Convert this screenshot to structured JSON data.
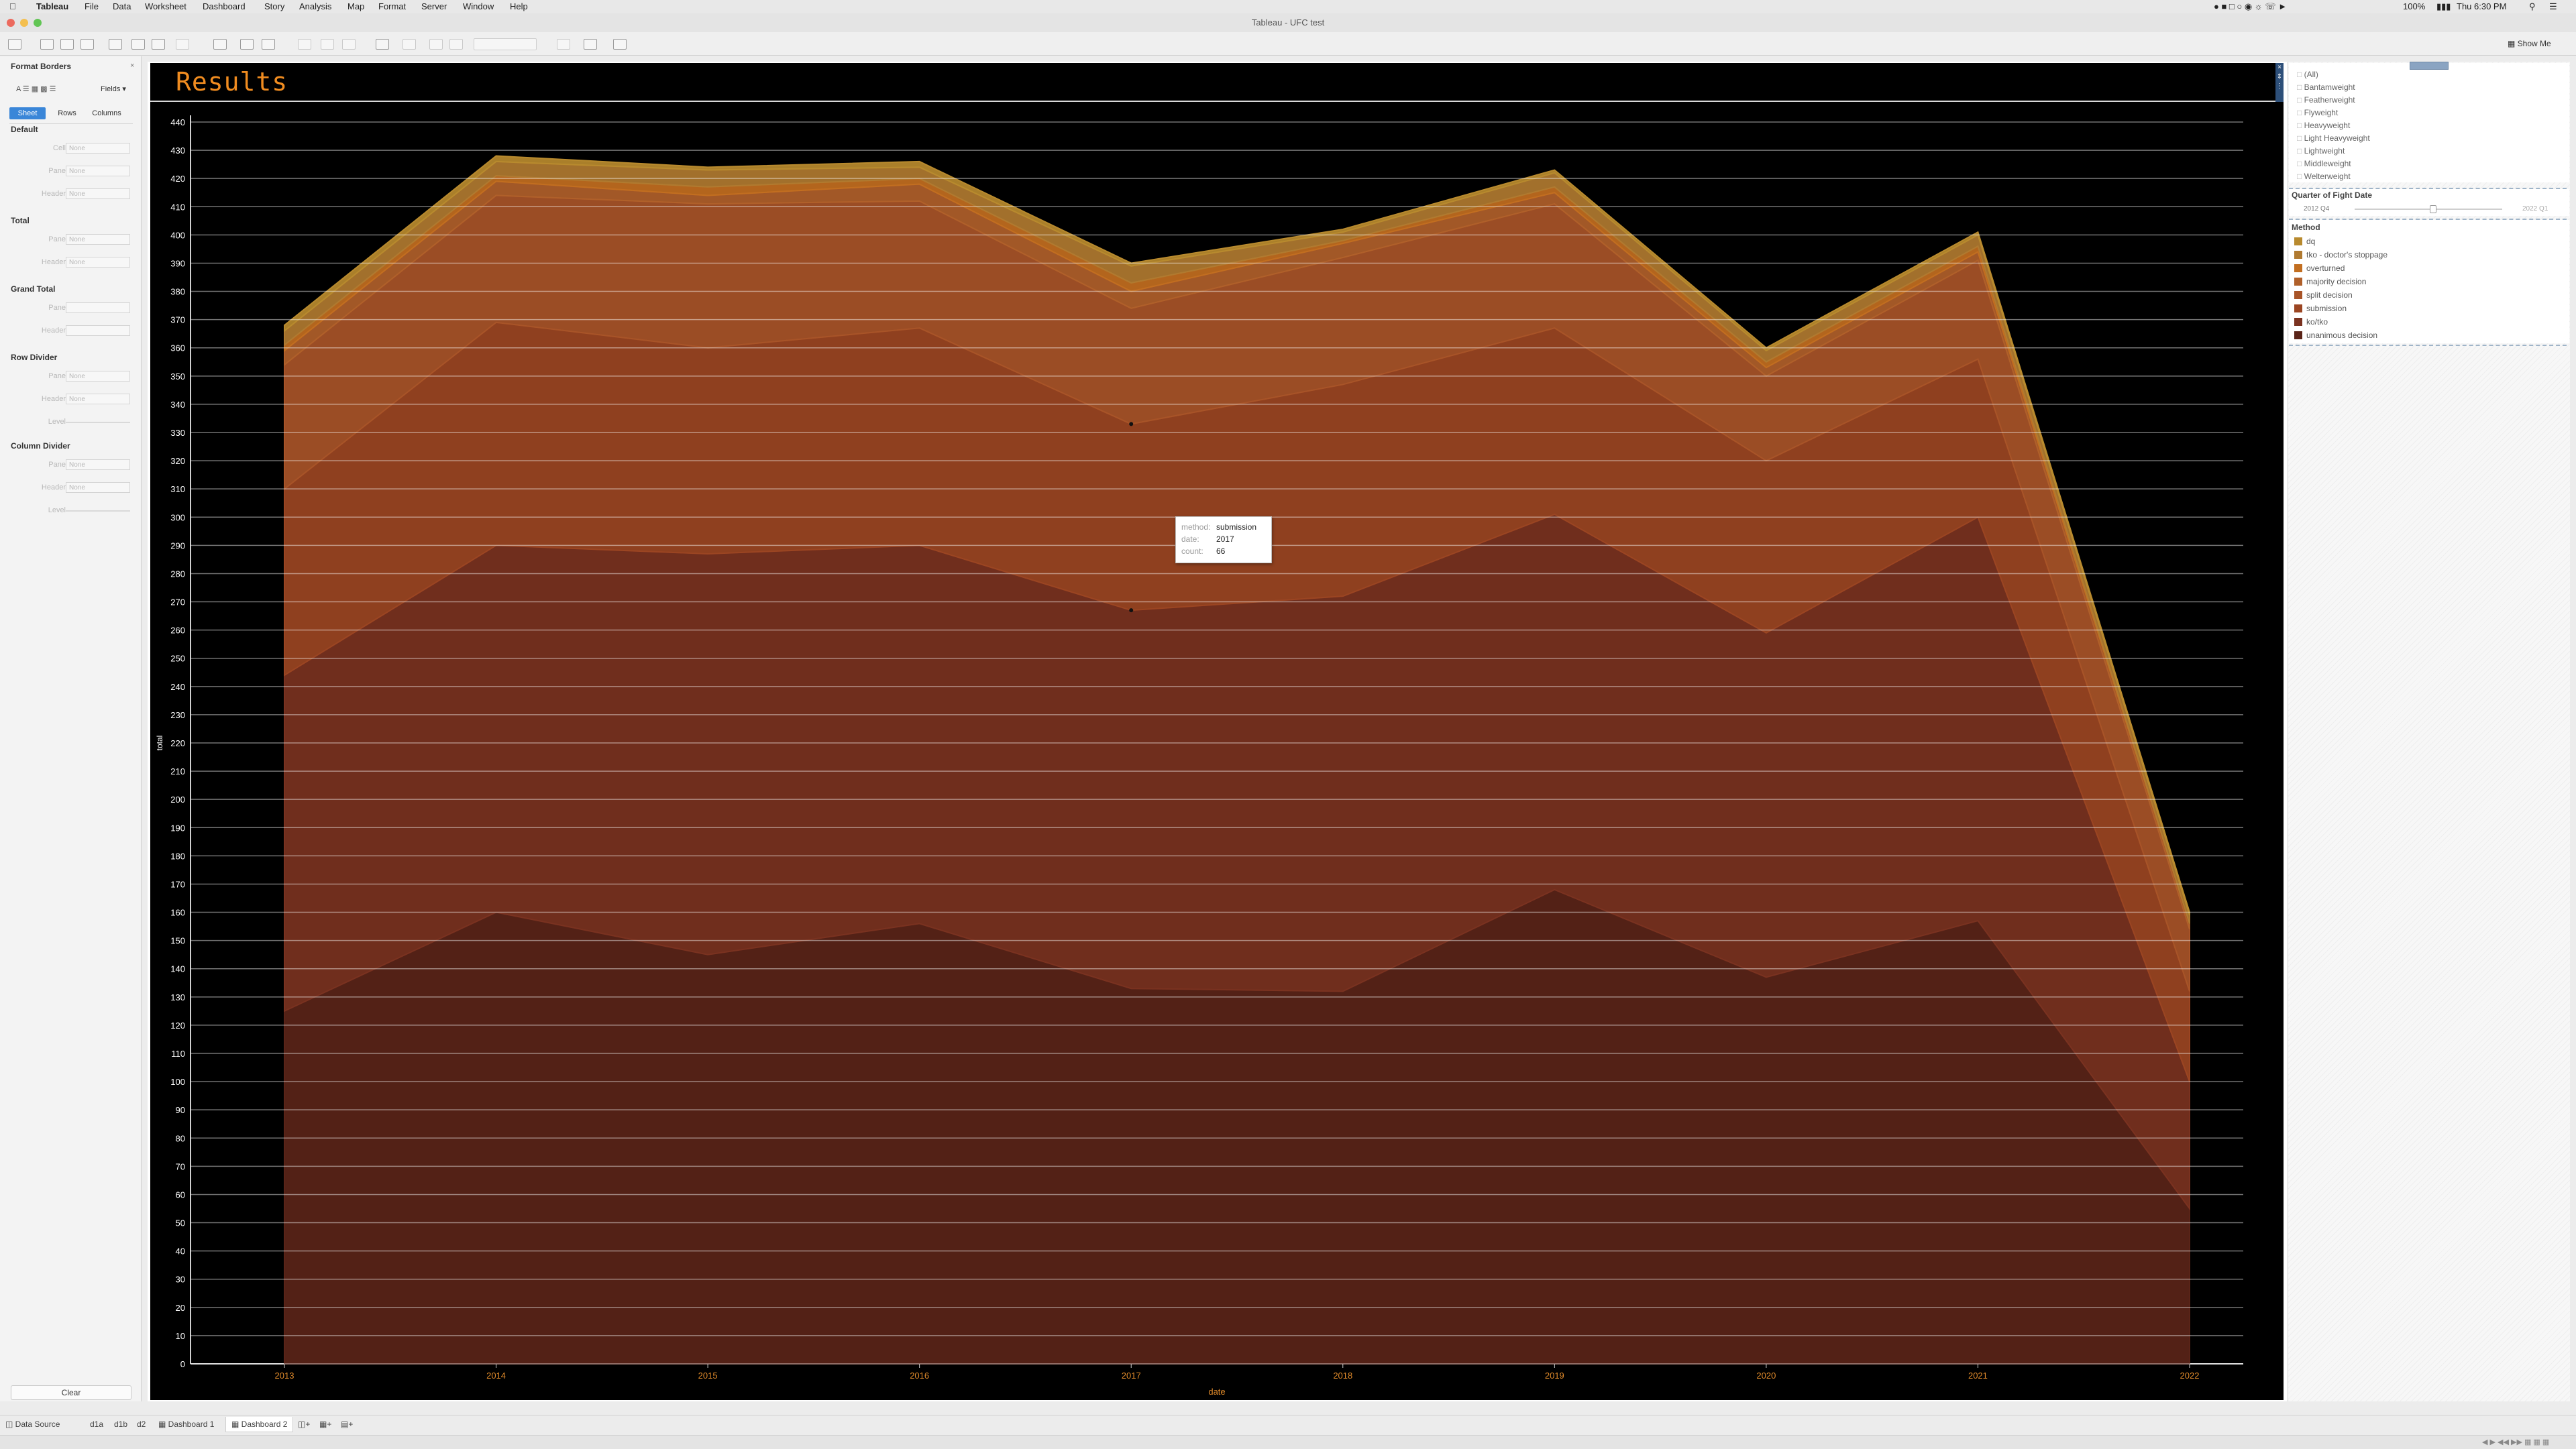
{
  "menubar": {
    "app_name": "Tableau",
    "items": [
      "File",
      "Data",
      "Worksheet",
      "Dashboard",
      "Story",
      "Analysis",
      "Map",
      "Format",
      "Server",
      "Window",
      "Help"
    ],
    "battery": "100%",
    "clock": "Thu 6:30 PM"
  },
  "window": {
    "title": "Tableau - UFC test",
    "show_me": "Show Me"
  },
  "format_panel": {
    "title": "Format Borders",
    "fields_button": "Fields ▾",
    "tabs": [
      "Sheet",
      "Rows",
      "Columns"
    ],
    "active_tab": "Sheet",
    "sections": [
      {
        "name": "Default",
        "rows": [
          {
            "label": "Cell",
            "value": "None"
          },
          {
            "label": "Pane",
            "value": "None"
          },
          {
            "label": "Header",
            "value": "None"
          }
        ]
      },
      {
        "name": "Total",
        "rows": [
          {
            "label": "Pane",
            "value": "None"
          },
          {
            "label": "Header",
            "value": "None"
          }
        ]
      },
      {
        "name": "Grand Total",
        "rows": [
          {
            "label": "Pane",
            "value": ""
          },
          {
            "label": "Header",
            "value": ""
          }
        ]
      },
      {
        "name": "Row Divider",
        "rows": [
          {
            "label": "Pane",
            "value": "None"
          },
          {
            "label": "Header",
            "value": "None"
          },
          {
            "label": "Level",
            "value": ""
          }
        ]
      },
      {
        "name": "Column Divider",
        "rows": [
          {
            "label": "Pane",
            "value": "None"
          },
          {
            "label": "Header",
            "value": "None"
          },
          {
            "label": "Level",
            "value": ""
          }
        ]
      }
    ],
    "clear_button": "Clear"
  },
  "sheet_title": "Results",
  "tooltip": {
    "rows": [
      {
        "key": "method:",
        "value": "submission"
      },
      {
        "key": "date:",
        "value": "2017"
      },
      {
        "key": "count:",
        "value": "66"
      }
    ]
  },
  "filter_weightclass": {
    "items": [
      "(All)",
      "Bantamweight",
      "Featherweight",
      "Flyweight",
      "Heavyweight",
      "Light Heavyweight",
      "Lightweight",
      "Middleweight",
      "Welterweight"
    ]
  },
  "filter_date": {
    "title": "Quarter of Fight Date",
    "start": "2012 Q4",
    "end": "2022 Q1"
  },
  "legend": {
    "title": "Method",
    "items": [
      {
        "label": "dq",
        "color": "#b88a2e"
      },
      {
        "label": "tko - doctor's stoppage",
        "color": "#b07a30"
      },
      {
        "label": "overturned",
        "color": "#c26e20"
      },
      {
        "label": "majority decision",
        "color": "#b0602a"
      },
      {
        "label": "split decision",
        "color": "#a85428"
      },
      {
        "label": "submission",
        "color": "#9b4522"
      },
      {
        "label": "ko/tko",
        "color": "#7a3220"
      },
      {
        "label": "unanimous decision",
        "color": "#5a2418"
      }
    ]
  },
  "bottom_tabs": {
    "items": [
      "Data Source",
      "d1a",
      "d1b",
      "d2",
      "Dashboard 1",
      "Dashboard 2"
    ],
    "active": "Dashboard 2"
  },
  "colors": {
    "title_accent": "#f08c20",
    "axis_text": "#ffffff",
    "x_tick_text": "#e08a2a"
  },
  "chart_data": {
    "type": "area",
    "stacked": true,
    "xlabel": "date",
    "ylabel": "total",
    "ylim": [
      0,
      440
    ],
    "y_ticks": [
      0,
      10,
      20,
      30,
      40,
      50,
      60,
      70,
      80,
      90,
      100,
      110,
      120,
      130,
      140,
      150,
      160,
      170,
      180,
      190,
      200,
      210,
      220,
      230,
      240,
      250,
      260,
      270,
      280,
      290,
      300,
      310,
      320,
      330,
      340,
      350,
      360,
      370,
      380,
      390,
      400,
      410,
      420,
      430,
      440
    ],
    "categories": [
      "2013",
      "2014",
      "2015",
      "2016",
      "2017",
      "2018",
      "2019",
      "2020",
      "2021",
      "2022"
    ],
    "grid": true,
    "series": [
      {
        "name": "unanimous decision",
        "color": "#5a2418",
        "values": [
          125,
          160,
          145,
          156,
          133,
          132,
          168,
          137,
          157,
          55
        ]
      },
      {
        "name": "ko/tko",
        "color": "#7a3220",
        "values": [
          119,
          130,
          142,
          134,
          134,
          140,
          133,
          122,
          143,
          45
        ]
      },
      {
        "name": "submission",
        "color": "#9b4522",
        "values": [
          66,
          79,
          73,
          77,
          66,
          75,
          66,
          61,
          56,
          32
        ]
      },
      {
        "name": "split decision",
        "color": "#a85428",
        "values": [
          44,
          45,
          51,
          45,
          41,
          45,
          44,
          30,
          35,
          22
        ]
      },
      {
        "name": "majority decision",
        "color": "#b0602a",
        "values": [
          5,
          5,
          3,
          6,
          6,
          5,
          4,
          3,
          3,
          2
        ]
      },
      {
        "name": "overturned",
        "color": "#c26e20",
        "values": [
          2,
          2,
          3,
          2,
          3,
          1,
          2,
          2,
          2,
          0
        ]
      },
      {
        "name": "tko - doctor's stoppage",
        "color": "#b07a30",
        "values": [
          5,
          5,
          6,
          4,
          6,
          3,
          5,
          4,
          4,
          3
        ]
      },
      {
        "name": "dq",
        "color": "#b88a2e",
        "values": [
          2,
          2,
          1,
          2,
          1,
          1,
          1,
          1,
          1,
          1
        ]
      }
    ]
  }
}
